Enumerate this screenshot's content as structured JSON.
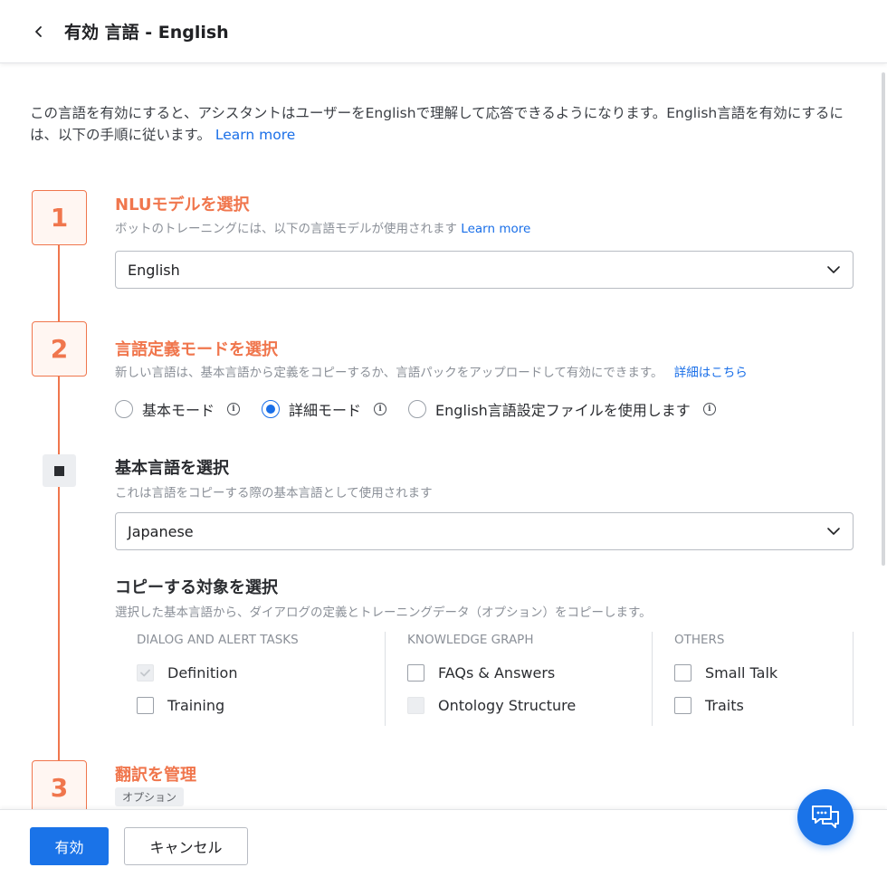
{
  "header": {
    "title": "有効 言語 - English",
    "back_icon": "chevron-left-icon"
  },
  "intro": {
    "text": "この言語を有効にすると、アシスタントはユーザーをEnglishで理解して応答できるようになります。English言語を有効にするには、以下の手順に従います。",
    "link": "Learn more"
  },
  "step1": {
    "number": "1",
    "title": "NLUモデルを選択",
    "desc": "ボットのトレーニングには、以下の言語モデルが使用されます",
    "link": "Learn more",
    "select_value": "English"
  },
  "step2": {
    "number": "2",
    "title": "言語定義モードを選択",
    "desc": "新しい言語は、基本言語から定義をコピーするか、言語パックをアップロードして有効にできます。",
    "link": "詳細はこちら",
    "modes": [
      {
        "label": "基本モード",
        "selected": false
      },
      {
        "label": "詳細モード",
        "selected": true
      },
      {
        "label": "English言語設定ファイルを使用します",
        "selected": false
      }
    ],
    "info_glyph": "i"
  },
  "base_language": {
    "title": "基本言語を選択",
    "desc": "これは言語をコピーする際の基本言語として使用されます",
    "select_value": "Japanese"
  },
  "copy_targets": {
    "title": "コピーする対象を選択",
    "desc": "選択した基本言語から、ダイアログの定義とトレーニングデータ（オプション）をコピーします。",
    "columns": [
      {
        "header": "DIALOG AND ALERT TASKS",
        "items": [
          {
            "label": "Definition",
            "state": "checked-disabled"
          },
          {
            "label": "Training",
            "state": "unchecked"
          }
        ]
      },
      {
        "header": "KNOWLEDGE GRAPH",
        "items": [
          {
            "label": "FAQs & Answers",
            "state": "unchecked"
          },
          {
            "label": "Ontology Structure",
            "state": "disabled"
          }
        ]
      },
      {
        "header": "OTHERS",
        "items": [
          {
            "label": "Small Talk",
            "state": "unchecked"
          },
          {
            "label": "Traits",
            "state": "unchecked"
          }
        ]
      }
    ]
  },
  "step3": {
    "number": "3",
    "title": "翻訳を管理",
    "badge": "オプション"
  },
  "footer": {
    "enable_label": "有効",
    "cancel_label": "キャンセル"
  },
  "colors": {
    "accent": "#f0764d",
    "primary": "#1a73e8",
    "link": "#1a6fe8"
  },
  "icons": {
    "chat": "chat-bubbles-icon",
    "chevron": "chevron-down-icon",
    "check": "check-icon"
  }
}
